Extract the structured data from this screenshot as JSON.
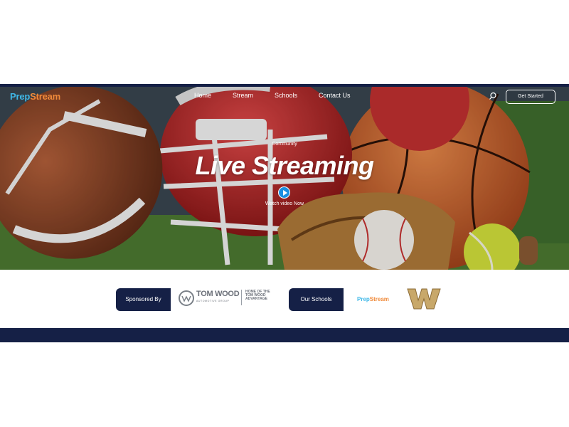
{
  "header": {
    "logo_part1": "Prep",
    "logo_part2": "Stream",
    "nav": [
      "Home",
      "Stream",
      "Schools",
      "Contact Us"
    ],
    "cta": "Get Started"
  },
  "hero": {
    "eyebrow": "Community",
    "title": "Live Streaming",
    "watch": "Watch video Now"
  },
  "sponsors": {
    "sponsored_label": "Sponsored By",
    "sponsor_name": "TOM WOOD",
    "sponsor_sub": "AUTOMOTIVE GROUP",
    "sponsor_tagline": "HOME OF THE TOM WOOD ADVANTAGE",
    "schools_label": "Our Schools",
    "school_logo_part1": "Prep",
    "school_logo_part2": "Stream",
    "school_letter": "W"
  },
  "colors": {
    "navy": "#152046",
    "accent_blue": "#3fb8e8",
    "accent_orange": "#f08a3a"
  }
}
